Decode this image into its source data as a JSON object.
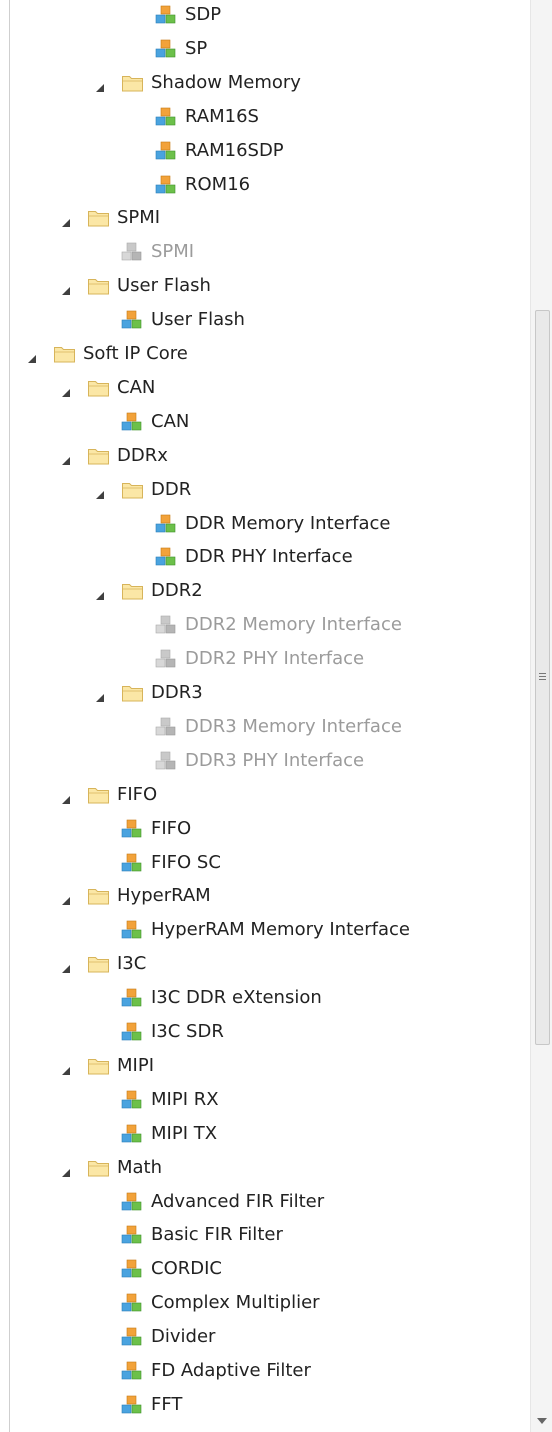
{
  "tree": {
    "items": [
      {
        "label": "SDP",
        "level": 4,
        "type": "ip",
        "disabled": false
      },
      {
        "label": "SP",
        "level": 4,
        "type": "ip",
        "disabled": false
      },
      {
        "label": "Shadow Memory",
        "level": 3,
        "type": "folder",
        "expanded": true
      },
      {
        "label": "RAM16S",
        "level": 4,
        "type": "ip",
        "disabled": false
      },
      {
        "label": "RAM16SDP",
        "level": 4,
        "type": "ip",
        "disabled": false
      },
      {
        "label": "ROM16",
        "level": 4,
        "type": "ip",
        "disabled": false
      },
      {
        "label": "SPMI",
        "level": 2,
        "type": "folder",
        "expanded": true
      },
      {
        "label": "SPMI",
        "level": 3,
        "type": "ip",
        "disabled": true
      },
      {
        "label": "User Flash",
        "level": 2,
        "type": "folder",
        "expanded": true
      },
      {
        "label": "User Flash",
        "level": 3,
        "type": "ip",
        "disabled": false
      },
      {
        "label": "Soft IP Core",
        "level": 1,
        "type": "folder",
        "expanded": true
      },
      {
        "label": "CAN",
        "level": 2,
        "type": "folder",
        "expanded": true
      },
      {
        "label": "CAN",
        "level": 3,
        "type": "ip",
        "disabled": false
      },
      {
        "label": "DDRx",
        "level": 2,
        "type": "folder",
        "expanded": true
      },
      {
        "label": "DDR",
        "level": 3,
        "type": "folder",
        "expanded": true
      },
      {
        "label": "DDR Memory Interface",
        "level": 4,
        "type": "ip",
        "disabled": false
      },
      {
        "label": "DDR PHY Interface",
        "level": 4,
        "type": "ip",
        "disabled": false
      },
      {
        "label": "DDR2",
        "level": 3,
        "type": "folder",
        "expanded": true
      },
      {
        "label": "DDR2 Memory Interface",
        "level": 4,
        "type": "ip",
        "disabled": true
      },
      {
        "label": "DDR2 PHY Interface",
        "level": 4,
        "type": "ip",
        "disabled": true
      },
      {
        "label": "DDR3",
        "level": 3,
        "type": "folder",
        "expanded": true
      },
      {
        "label": "DDR3 Memory Interface",
        "level": 4,
        "type": "ip",
        "disabled": true
      },
      {
        "label": "DDR3 PHY Interface",
        "level": 4,
        "type": "ip",
        "disabled": true
      },
      {
        "label": "FIFO",
        "level": 2,
        "type": "folder",
        "expanded": true
      },
      {
        "label": "FIFO",
        "level": 3,
        "type": "ip",
        "disabled": false
      },
      {
        "label": "FIFO SC",
        "level": 3,
        "type": "ip",
        "disabled": false
      },
      {
        "label": "HyperRAM",
        "level": 2,
        "type": "folder",
        "expanded": true
      },
      {
        "label": "HyperRAM Memory Interface",
        "level": 3,
        "type": "ip",
        "disabled": false
      },
      {
        "label": "I3C",
        "level": 2,
        "type": "folder",
        "expanded": true
      },
      {
        "label": "I3C DDR eXtension",
        "level": 3,
        "type": "ip",
        "disabled": false
      },
      {
        "label": "I3C SDR",
        "level": 3,
        "type": "ip",
        "disabled": false
      },
      {
        "label": "MIPI",
        "level": 2,
        "type": "folder",
        "expanded": true
      },
      {
        "label": "MIPI RX",
        "level": 3,
        "type": "ip",
        "disabled": false
      },
      {
        "label": "MIPI TX",
        "level": 3,
        "type": "ip",
        "disabled": false
      },
      {
        "label": "Math",
        "level": 2,
        "type": "folder",
        "expanded": true
      },
      {
        "label": "Advanced FIR Filter",
        "level": 3,
        "type": "ip",
        "disabled": false
      },
      {
        "label": "Basic FIR Filter",
        "level": 3,
        "type": "ip",
        "disabled": false
      },
      {
        "label": "CORDIC",
        "level": 3,
        "type": "ip",
        "disabled": false
      },
      {
        "label": "Complex Multiplier",
        "level": 3,
        "type": "ip",
        "disabled": false
      },
      {
        "label": "Divider",
        "level": 3,
        "type": "ip",
        "disabled": false
      },
      {
        "label": "FD Adaptive Filter",
        "level": 3,
        "type": "ip",
        "disabled": false
      },
      {
        "label": "FFT",
        "level": 3,
        "type": "ip",
        "disabled": false
      }
    ]
  },
  "colors": {
    "folder_fill": "#fbe7a6",
    "folder_stroke": "#d7b45a",
    "cube_orange": "#f2a23a",
    "cube_green": "#6cc04a",
    "cube_blue": "#4aa3df",
    "cube_gray": "#c9c9c9",
    "disabled_text": "#9b9b9b"
  },
  "icons": {
    "folder": "folder-icon",
    "ip": "ip-core-icon",
    "expand": "expanded-triangle-icon"
  }
}
